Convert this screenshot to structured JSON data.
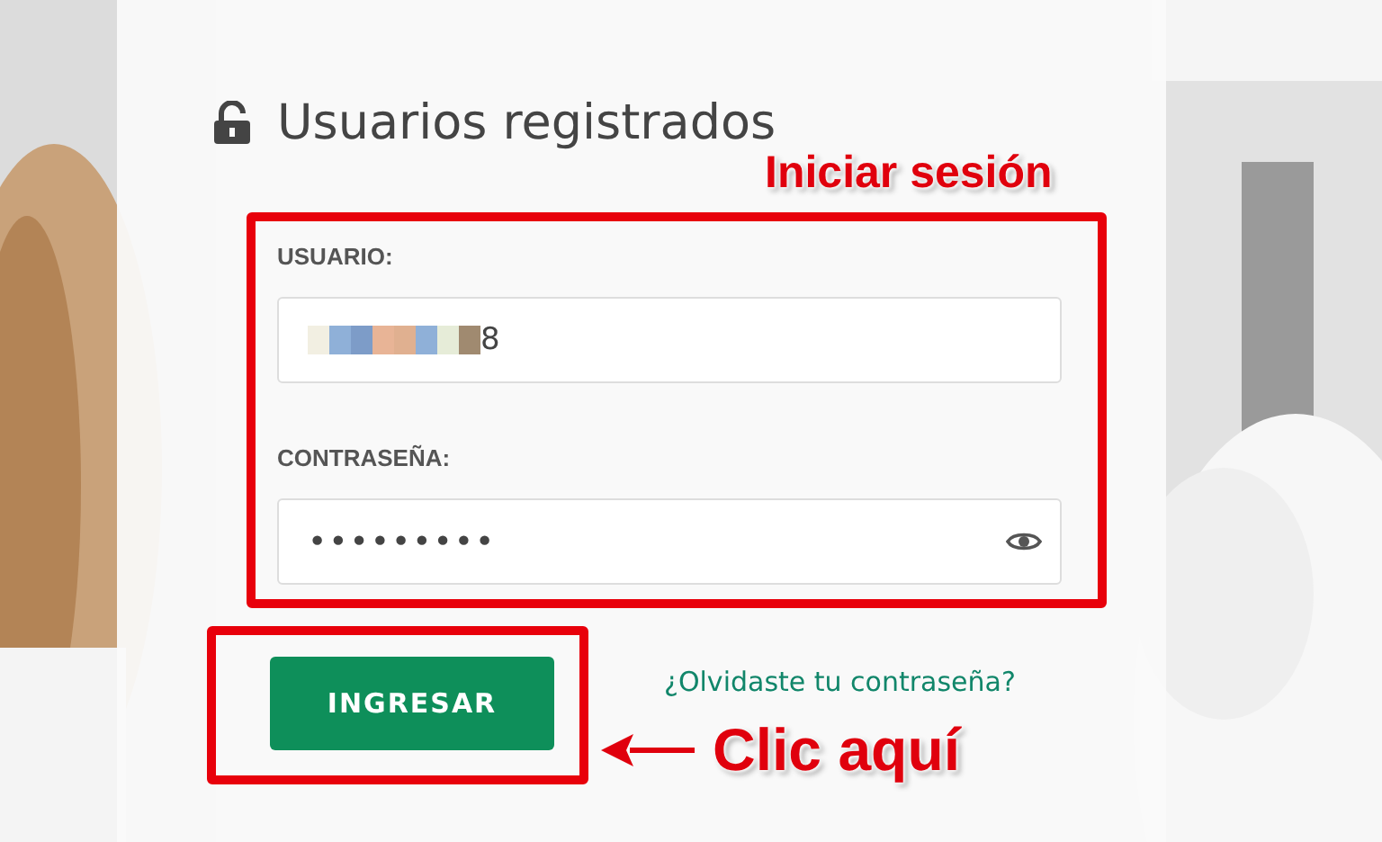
{
  "title": "Usuarios registrados",
  "annotations": {
    "login_label": "Iniciar sesión",
    "click_label": "Clic aquí"
  },
  "fields": [
    {
      "kind": "text",
      "label": "USUARIO:",
      "value": "8"
    },
    {
      "kind": "password",
      "label": "CONTRASEÑA:",
      "value": "•••••••••"
    }
  ],
  "submit_button": "INGRESAR",
  "forgot_link": "¿Olvidaste tu contraseña?"
}
